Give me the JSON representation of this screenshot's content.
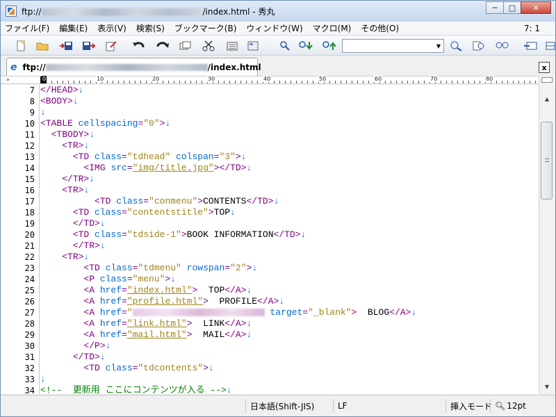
{
  "window": {
    "title_prefix": "ftp://",
    "title_suffix": "/index.html  - 秀丸",
    "buttons": {
      "minimize": "─",
      "maximize": "□",
      "close": "✕"
    }
  },
  "menu": {
    "items": [
      "ファイル(F)",
      "編集(E)",
      "表示(V)",
      "検索(S)",
      "ブックマーク(B)",
      "ウィンドウ(W)",
      "マクロ(M)",
      "その他(O)"
    ],
    "position": "7: 1"
  },
  "toolbar": {
    "search_value": ""
  },
  "tab": {
    "prefix": "ftp://",
    "suffix": "/index.html",
    "close": "x"
  },
  "ruler": {
    "start": "»",
    "labels": [
      "0",
      "10",
      "20",
      "30",
      "40",
      "50",
      "60",
      "70",
      "80"
    ]
  },
  "editor": {
    "line_numbers": [
      "7",
      "8",
      "9",
      "10",
      "11",
      "12",
      "13",
      "14",
      "15",
      "16",
      "17",
      "18",
      "19",
      "20",
      "21",
      "22",
      "23",
      "24",
      "25",
      "26",
      "27",
      "28",
      "29",
      "30",
      "31",
      "32",
      "33",
      "34"
    ],
    "nl": "↓",
    "l7_tag": "</HEAD>",
    "l8_tag": "<BODY>",
    "l10_tag": "<TABLE",
    "l10_attr": " cellspacing",
    "l10_eq": "=",
    "l10_val": "\"0\"",
    "l10_close": ">",
    "l11_tag": "<TBODY>",
    "l12_tag": "<TR>",
    "l13_tag": "<TD",
    "l13_attr1": " class",
    "l13_val1": "\"tdhead\"",
    "l13_attr2": " colspan",
    "l13_val2": "\"3\"",
    "l14_tag": "<IMG",
    "l14_attr": " src",
    "l14_val": "\"img/title.jpg\"",
    "l14_close": "></TD>",
    "l15_tag": "</TR>",
    "l16_tag": "<TR>",
    "l17_tag": "<TD",
    "l17_attr": " class",
    "l17_val": "\"conmenu\"",
    "l17_text": "CONTENTS",
    "l17_end": "</TD>",
    "l18_tag": "<TD",
    "l18_attr": " class",
    "l18_val": "\"contentstitle\"",
    "l18_text": "TOP",
    "l19_tag": "</TD>",
    "l20_tag": "<TD",
    "l20_attr": " class",
    "l20_val": "\"tdside-1\"",
    "l20_text": "BOOK INFORMATION",
    "l20_end": "</TD>",
    "l21_tag": "</TR>",
    "l22_tag": "<TR>",
    "l23_tag": "<TD",
    "l23_attr1": " class",
    "l23_val1": "\"tdmenu\"",
    "l23_attr2": " rowspan",
    "l23_val2": "\"2\"",
    "l24_tag": "<P",
    "l24_attr": " class",
    "l24_val": "\"menu\"",
    "a_tag": "<A",
    "a_attr": " href",
    "a_end": "</A>",
    "l25_val": "\"index.html\"",
    "l25_text": "  TOP",
    "l26_val": "\"profile.html\"",
    "l26_text": "  PROFILE",
    "l27_val_open": "\"",
    "l27_attr2": " target",
    "l27_val2": "\"_blank\"",
    "l27_text": "  BLOG",
    "l28_val": "\"link.html\"",
    "l28_text": "  LINK",
    "l29_val": "\"mail.html\"",
    "l29_text": "  MAIL",
    "l30_tag": "</P>",
    "l31_tag": "</TD>",
    "l32_tag": "<TD",
    "l32_attr": " class",
    "l32_val": "\"tdcontents\"",
    "l34_comment": "<!--  更新用 ここにコンテンツが入る -->"
  },
  "status": {
    "encoding": "日本語(Shift-JIS)",
    "newline": "LF",
    "mode": "挿入モード",
    "font_size": "12pt"
  }
}
